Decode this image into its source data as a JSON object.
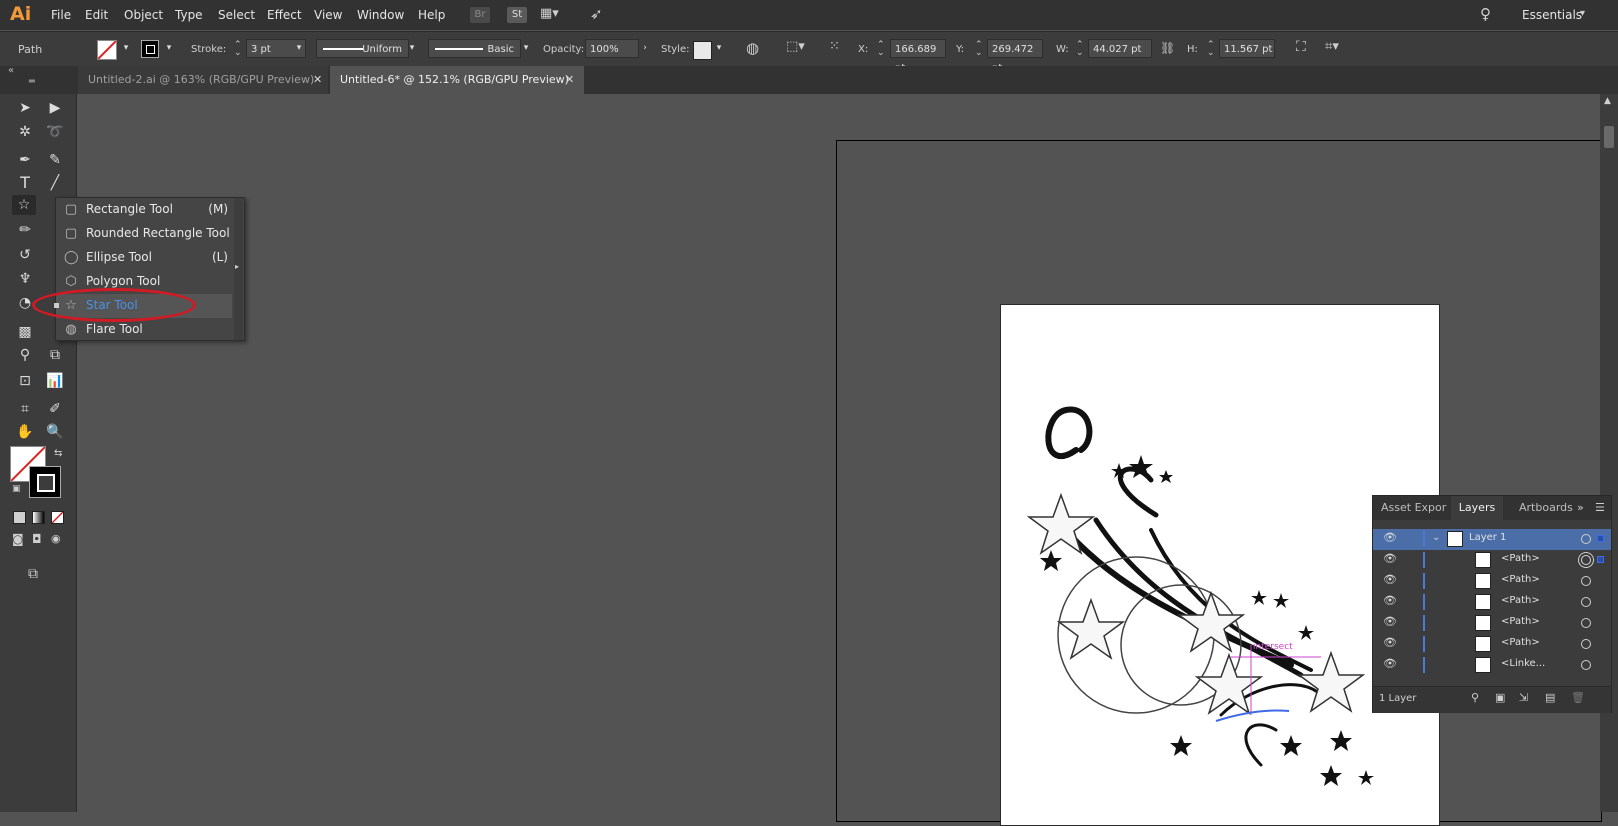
{
  "app": {
    "logo": "Ai"
  },
  "menubar": {
    "items": [
      "File",
      "Edit",
      "Object",
      "Type",
      "Select",
      "Effect",
      "View",
      "Window",
      "Help"
    ],
    "bridge": "Br",
    "stock": "St",
    "workspace": "Essentials"
  },
  "control": {
    "selection": "Path",
    "stroke_label": "Stroke:",
    "stroke_weight": "3 pt",
    "profile": "Uniform",
    "brush": "Basic",
    "opacity_label": "Opacity:",
    "opacity": "100%",
    "style_label": "Style:",
    "x_label": "X:",
    "x": "166.689 pt",
    "y_label": "Y:",
    "y": "269.472 pt",
    "w_label": "W:",
    "w": "44.027 pt",
    "h_label": "H:",
    "h": "11.567 pt"
  },
  "tabs": [
    {
      "label": "Untitled-2.ai @ 163% (RGB/GPU Preview)",
      "active": false
    },
    {
      "label": "Untitled-6* @ 152.1% (RGB/GPU Preview)",
      "active": true
    }
  ],
  "flyout": {
    "items": [
      {
        "label": "Rectangle Tool",
        "key": "(M)",
        "icon": "rectangle-icon"
      },
      {
        "label": "Rounded Rectangle Tool",
        "key": "",
        "icon": "rounded-rectangle-icon"
      },
      {
        "label": "Ellipse Tool",
        "key": "(L)",
        "icon": "ellipse-icon"
      },
      {
        "label": "Polygon Tool",
        "key": "",
        "icon": "polygon-icon"
      },
      {
        "label": "Star Tool",
        "key": "",
        "icon": "star-icon",
        "selected": true
      },
      {
        "label": "Flare Tool",
        "key": "",
        "icon": "flare-icon"
      }
    ]
  },
  "layers_panel": {
    "tabs": [
      "Asset Expor",
      "Layers",
      "Artboards"
    ],
    "layer_name": "Layer 1",
    "sublayers": [
      "<Path>",
      "<Path>",
      "<Path>",
      "<Path>",
      "<Path>",
      "<Linke..."
    ],
    "footer": "1 Layer"
  },
  "canvas": {
    "smart_guide": "intersect"
  },
  "colors": {
    "accent": "#4a90e2",
    "callout": "#d11b24",
    "selection": "#3f6be8"
  }
}
